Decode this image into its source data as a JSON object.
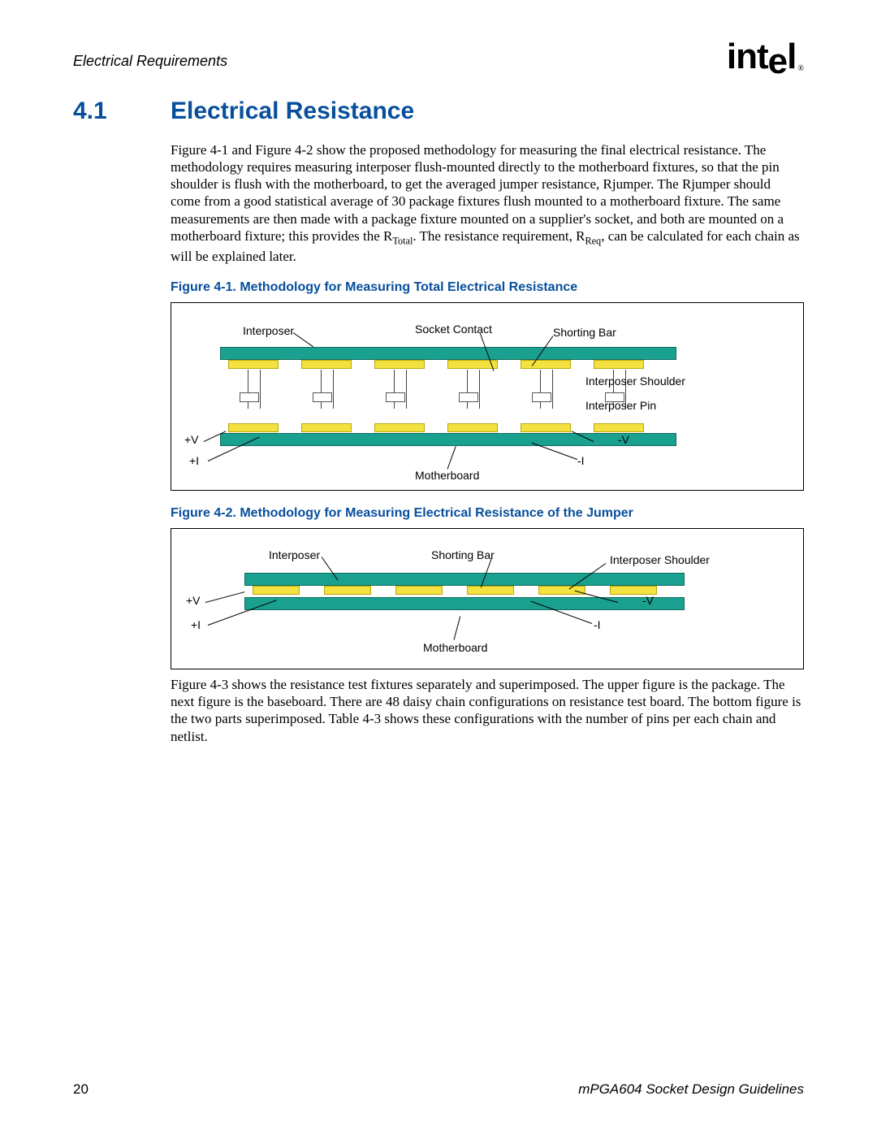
{
  "header": {
    "running_head": "Electrical Requirements",
    "logo_text": "intel",
    "logo_reg": "®"
  },
  "section": {
    "number": "4.1",
    "title": "Electrical Resistance"
  },
  "para1_a": "Figure 4-1 and Figure 4-2 show the proposed methodology for measuring the final electrical resistance. The methodology requires measuring interposer flush-mounted directly to the motherboard fixtures, so that the pin shoulder is flush with the motherboard, to get the averaged jumper resistance, Rjumper. The Rjumper should come from a good statistical average of 30 package fixtures flush mounted to a motherboard fixture. The same measurements are then made with a package fixture mounted on a supplier's socket, and both are mounted on a motherboard fixture; this provides the R",
  "para1_sub1": "Total",
  "para1_b": ". The resistance requirement, R",
  "para1_sub2": "Req",
  "para1_c": ", can be calculated for each chain as will be explained later.",
  "fig1": {
    "caption": "Figure 4-1. Methodology for Measuring Total Electrical Resistance",
    "labels": {
      "interposer": "Interposer",
      "socket_contact": "Socket Contact",
      "shorting_bar": "Shorting Bar",
      "interposer_shoulder": "Interposer Shoulder",
      "interposer_pin": "Interposer Pin",
      "plus_v": "+V",
      "plus_i": "+I",
      "minus_v": "-V",
      "minus_i": "-I",
      "motherboard": "Motherboard"
    }
  },
  "fig2": {
    "caption": "Figure 4-2. Methodology for Measuring Electrical Resistance of the Jumper",
    "labels": {
      "interposer": "Interposer",
      "shorting_bar": "Shorting Bar",
      "interposer_shoulder": "Interposer Shoulder",
      "plus_v": "+V",
      "plus_i": "+I",
      "minus_v": "-V",
      "minus_i": "-I",
      "motherboard": "Motherboard"
    }
  },
  "para2": "Figure 4-3 shows the resistance test fixtures separately and superimposed. The upper figure is the package. The next figure is the baseboard. There are 48 daisy chain configurations on resistance test board. The bottom figure is the two parts superimposed. Table 4-3 shows these configurations with the number of pins per each chain and netlist.",
  "footer": {
    "page": "20",
    "doc": "mPGA604 Socket Design Guidelines"
  }
}
